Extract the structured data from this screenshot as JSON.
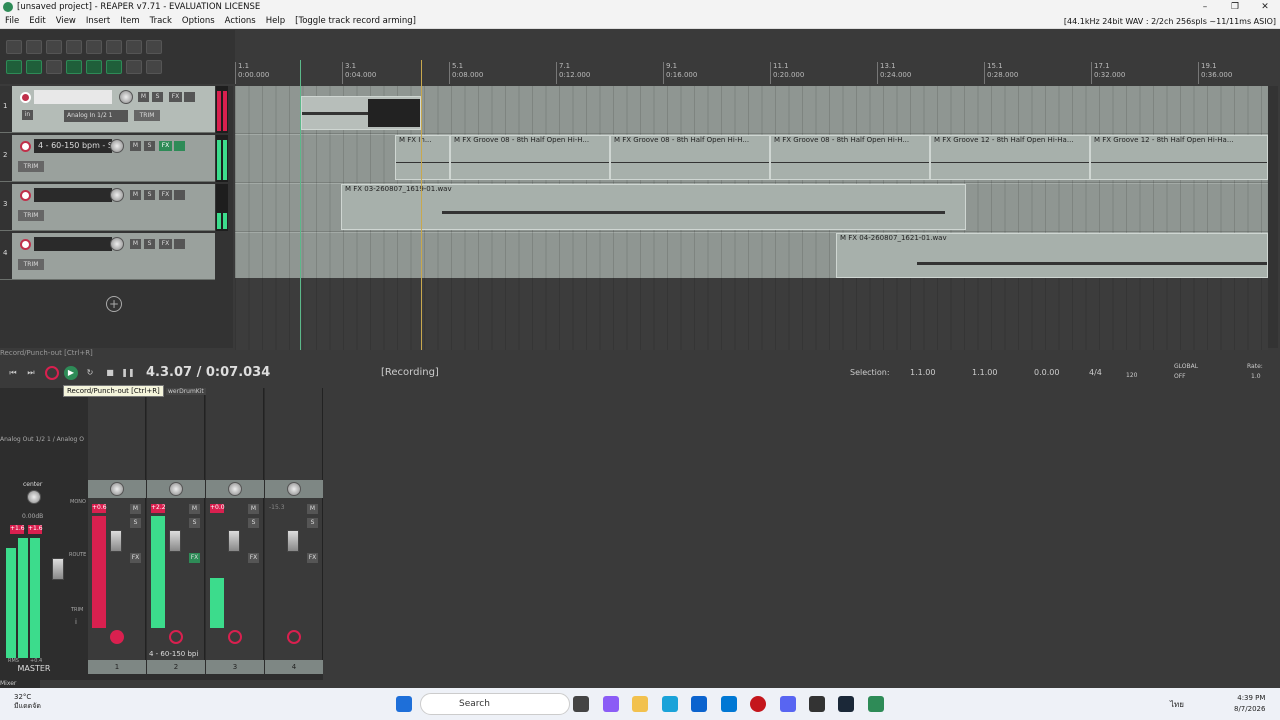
{
  "window": {
    "title": "[unsaved project] - REAPER v7.71 - EVALUATION LICENSE",
    "controls": [
      "–",
      "❐",
      "✕"
    ]
  },
  "menubar": {
    "items": [
      "File",
      "Edit",
      "View",
      "Insert",
      "Item",
      "Track",
      "Options",
      "Actions",
      "Help",
      "[Toggle track record arming]"
    ],
    "status": "[44.1kHz 24bit WAV : 2/2ch 256spls ~11/11ms ASIO]"
  },
  "tracks": [
    {
      "number": "1",
      "name": "",
      "input": "Analog In 1/2 1",
      "armed": true
    },
    {
      "number": "2",
      "name": "4 - 60-150 bpm - S",
      "trim": "TRIM",
      "armed": false
    },
    {
      "number": "3",
      "name": "",
      "trim": "TRIM",
      "armed": false
    },
    {
      "number": "4",
      "name": "",
      "trim": "TRIM",
      "armed": false
    }
  ],
  "track_buttons": {
    "mute": "M",
    "solo": "S",
    "fx": "FX",
    "trim": "TRIM",
    "in": "in"
  },
  "ruler": {
    "ticks": [
      {
        "bar": "1.1",
        "time": "0:00.000"
      },
      {
        "bar": "3.1",
        "time": "0:04.000"
      },
      {
        "bar": "5.1",
        "time": "0:08.000"
      },
      {
        "bar": "7.1",
        "time": "0:12.000"
      },
      {
        "bar": "9.1",
        "time": "0:16.000"
      },
      {
        "bar": "11.1",
        "time": "0:20.000"
      },
      {
        "bar": "13.1",
        "time": "0:24.000"
      },
      {
        "bar": "15.1",
        "time": "0:28.000"
      },
      {
        "bar": "17.1",
        "time": "0:32.000"
      },
      {
        "bar": "19.1",
        "time": "0:36.000"
      }
    ]
  },
  "items": {
    "groove1": "M FX In...",
    "groove2": "M FX Groove 08 - 8th Half Open Hi-H...",
    "groove3": "M FX Groove 08 - 8th Half Open Hi-H...",
    "groove4": "M FX Groove 08 - 8th Half Open Hi-H...",
    "groove5": "M FX Groove 12 - 8th Half Open Hi-Ha...",
    "groove6": "M FX Groove 12 - 8th Half Open Hi-Ha...",
    "wav3": "M FX 03-260807_1619-01.wav",
    "wav4": "M FX 04-260807_1621-01.wav"
  },
  "transport": {
    "status_line": "Record/Punch-out [Ctrl+R]",
    "time": "4.3.07 / 0:07.034",
    "state": "[Recording]",
    "selection_label": "Selection:",
    "sel_start": "1.1.00",
    "sel_end": "1.1.00",
    "sel_len": "0.0.00",
    "timesig": "4/4",
    "bpm": "120",
    "global": "GLOBAL",
    "global_off": "OFF",
    "rate_label": "Rate:",
    "rate": "1.0",
    "tooltip": "Record/Punch-out [Ctrl+R]",
    "tooltip_tail": "werDrumKit"
  },
  "mixer": {
    "master_output": "Analog Out 1/2 1 / Analog O",
    "master_pan": "center",
    "master_vol": "0.00dB",
    "master_peak_l": "+1.6",
    "master_peak_r": "+1.6",
    "master_rms": "RMS",
    "master_rms_val": "+0.4",
    "master_label": "MASTER",
    "mono": "MONO",
    "route": "ROUTE",
    "trim": "TRIM",
    "info": "i",
    "channel_peaks": [
      "+0.6",
      "+2.2",
      "+0.0",
      "-15.3"
    ],
    "channel_numbers": [
      "1",
      "2",
      "3",
      "4"
    ],
    "channel2_name": "4 - 60-150 bpi",
    "tab": "Mixer"
  },
  "taskbar": {
    "temp": "32°C",
    "weather": "มีแดดจัด",
    "search": "Search",
    "clock_time": "4:39 PM",
    "clock_date": "8/7/2026",
    "lang": "ไทย"
  },
  "colors": {
    "accent_green": "#3cdc8c",
    "record_red": "#c0304a",
    "peak_red": "#d9204f"
  }
}
